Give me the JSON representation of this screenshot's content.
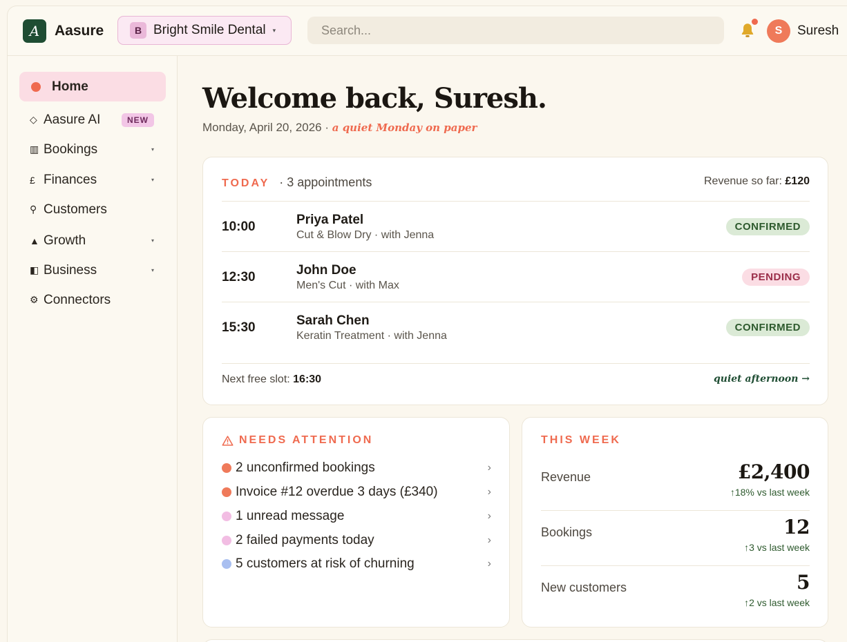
{
  "brand": {
    "logo_letter": "A",
    "name": "Aasure"
  },
  "workspace": {
    "badge": "B",
    "name": "Bright Smile Dental",
    "caret": "▾"
  },
  "search": {
    "placeholder": "Search..."
  },
  "user": {
    "initial": "S",
    "name": "Suresh"
  },
  "sidebar": {
    "items": [
      {
        "icon": "●",
        "label": "Home",
        "active": true
      },
      {
        "icon": "◇",
        "label": "Aasure AI",
        "badge": "NEW"
      },
      {
        "icon": "▥",
        "label": "Bookings",
        "caret": "▾"
      },
      {
        "icon": "£",
        "label": "Finances",
        "caret": "▾"
      },
      {
        "icon": "⚲",
        "label": "Customers"
      },
      {
        "icon": "▲",
        "label": "Growth",
        "caret": "▾"
      },
      {
        "icon": "◧",
        "label": "Business",
        "caret": "▾"
      },
      {
        "icon": "⚙",
        "label": "Connectors"
      }
    ]
  },
  "main": {
    "welcome": "Welcome back, Suresh.",
    "date": "Monday, April 20, 2026 · ",
    "quiet_note": "a quiet Monday on paper"
  },
  "today": {
    "label": "TODAY",
    "count": "· 3 appointments",
    "revenue_label": "Revenue so far: ",
    "revenue_value": "£120",
    "appointments": [
      {
        "time": "10:00",
        "name": "Priya Patel",
        "detail": "Cut & Blow Dry · with Jenna",
        "status": "CONFIRMED"
      },
      {
        "time": "12:30",
        "name": "John Doe",
        "detail": "Men's Cut · with Max",
        "status": "PENDING"
      },
      {
        "time": "15:30",
        "name": "Sarah Chen",
        "detail": "Keratin Treatment · with Jenna",
        "status": "CONFIRMED"
      }
    ],
    "next_slot_label": "Next free slot: ",
    "next_slot_value": "16:30",
    "quiet_link": "quiet afternoon →"
  },
  "attention": {
    "title": "NEEDS ATTENTION",
    "items": [
      {
        "text": "2 unconfirmed bookings",
        "color": "#ef7a5a"
      },
      {
        "text": "Invoice #12 overdue 3 days (£340)",
        "color": "#ef7a5a"
      },
      {
        "text": "1 unread message",
        "color": "#f2bde3"
      },
      {
        "text": "2 failed payments today",
        "color": "#f2bde3"
      },
      {
        "text": "5 customers at risk of churning",
        "color": "#a9bff0"
      }
    ],
    "chevron": "›"
  },
  "week": {
    "title": "THIS WEEK",
    "stats": [
      {
        "label": "Revenue",
        "value": "£2,400",
        "delta": "↑18% vs last week"
      },
      {
        "label": "Bookings",
        "value": "12",
        "delta": "↑3 vs last week"
      },
      {
        "label": "New customers",
        "value": "5",
        "delta": "↑2 vs last week"
      }
    ]
  },
  "colors": {
    "accent": "#ef6a4f",
    "brand_green": "#1f4d33",
    "confirmed_bg": "#dbead6",
    "pending_bg": "#fbdde4"
  }
}
